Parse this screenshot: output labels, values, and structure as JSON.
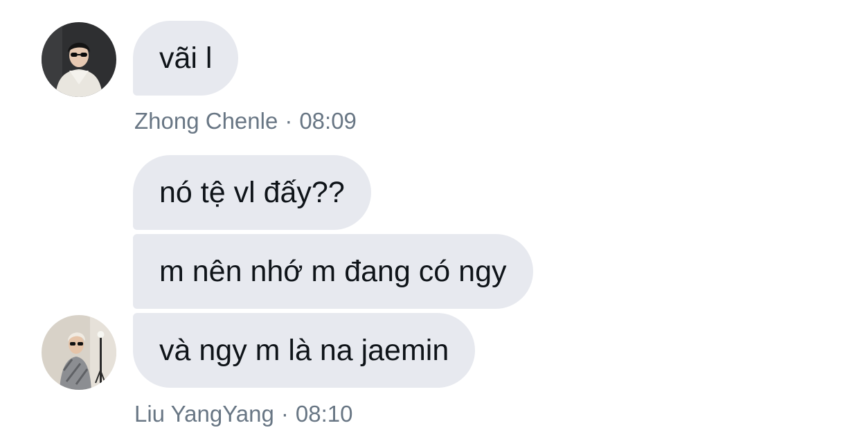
{
  "conversation": {
    "groups": [
      {
        "sender": "Zhong Chenle",
        "time": "08:09",
        "messages": [
          "vãi l"
        ]
      },
      {
        "sender": "Liu YangYang",
        "time": "08:10",
        "messages": [
          "nó tệ vl đấy??",
          "m nên nhớ m đang có ngy",
          "và ngy m là na jaemin"
        ]
      }
    ],
    "separator": "·"
  },
  "colors": {
    "bubble_bg": "#e7e9ef",
    "text": "#0f1419",
    "meta_text": "#687684",
    "background": "#ffffff"
  }
}
